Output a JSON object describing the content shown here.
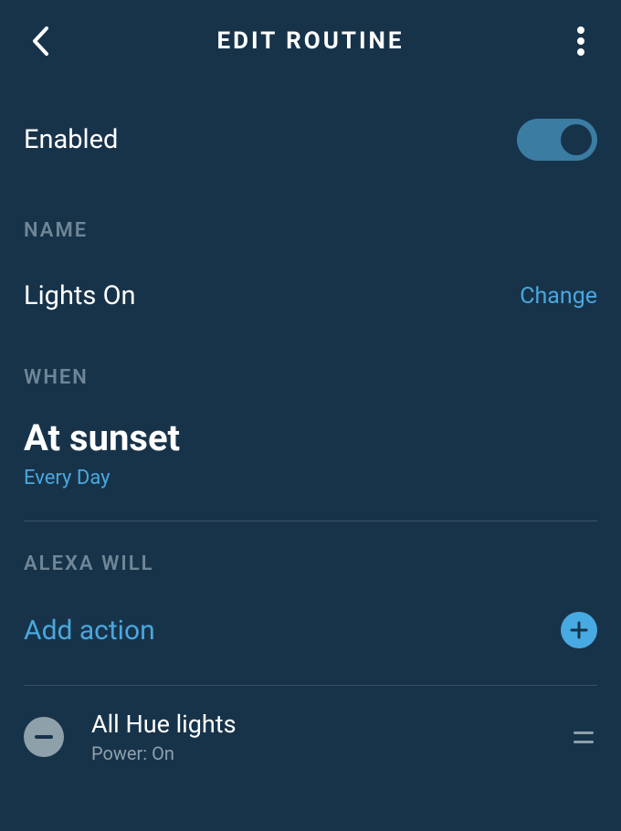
{
  "header": {
    "title": "EDIT ROUTINE"
  },
  "enabled": {
    "label": "Enabled",
    "value": true
  },
  "sections": {
    "name_label": "NAME",
    "when_label": "WHEN",
    "alexa_label": "ALEXA WILL"
  },
  "name": {
    "value": "Lights On",
    "change_label": "Change"
  },
  "when": {
    "title": "At sunset",
    "recurrence": "Every Day"
  },
  "add_action": {
    "label": "Add action"
  },
  "actions": [
    {
      "title": "All Hue lights",
      "subtitle": "Power: On"
    }
  ]
}
